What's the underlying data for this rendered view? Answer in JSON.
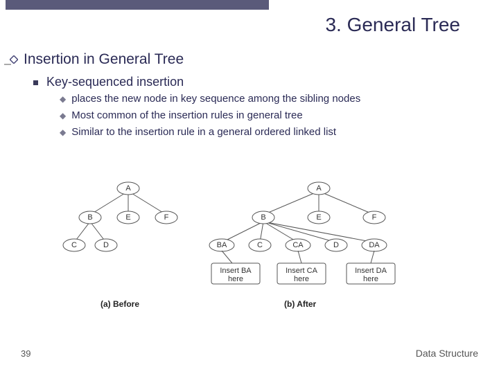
{
  "title": "3. General Tree",
  "section": "Insertion in General Tree",
  "subsection": "Key-sequenced insertion",
  "bullets": [
    "places the new node in key sequence among the sibling nodes",
    "Most common of the insertion rules in general tree",
    "Similar to the insertion rule in a general ordered linked list"
  ],
  "figure": {
    "caption_a": "(a) Before",
    "caption_b": "(b) After",
    "before": {
      "root": "A",
      "children": [
        "B",
        "E",
        "F"
      ],
      "b_children": [
        "C",
        "D"
      ]
    },
    "after": {
      "root": "A",
      "children": [
        "B",
        "E",
        "F"
      ],
      "b_children": [
        "BA",
        "C",
        "CA",
        "D",
        "DA"
      ],
      "inserts": [
        {
          "label": "Insert BA\nhere"
        },
        {
          "label": "Insert CA\nhere"
        },
        {
          "label": "Insert DA\nhere"
        }
      ]
    }
  },
  "footer": {
    "page": "39",
    "course": "Data Structure"
  }
}
